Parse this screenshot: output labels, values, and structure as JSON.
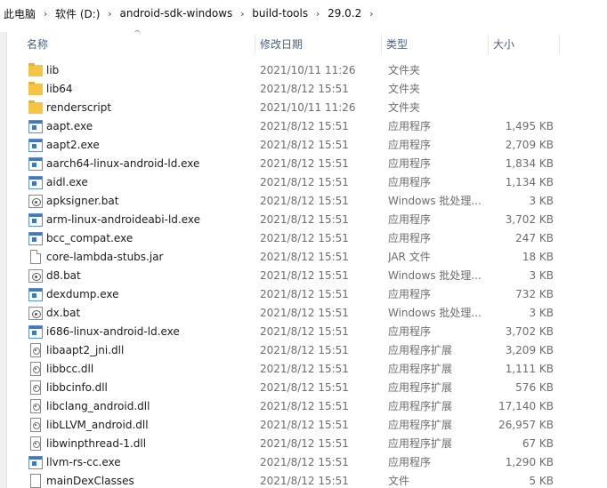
{
  "breadcrumb": {
    "items": [
      "此电脑",
      "软件 (D:)",
      "android-sdk-windows",
      "build-tools",
      "29.0.2"
    ],
    "separator": "›"
  },
  "columns": {
    "name": "名称",
    "date": "修改日期",
    "type": "类型",
    "size": "大小",
    "sort_indicator": "^"
  },
  "files": [
    {
      "name": "lib",
      "date": "2021/10/11 11:26",
      "type": "文件夹",
      "size": "",
      "icon": "folder-icon"
    },
    {
      "name": "lib64",
      "date": "2021/8/12 15:51",
      "type": "文件夹",
      "size": "",
      "icon": "folder-icon"
    },
    {
      "name": "renderscript",
      "date": "2021/10/11 11:26",
      "type": "文件夹",
      "size": "",
      "icon": "folder-icon"
    },
    {
      "name": "aapt.exe",
      "date": "2021/8/12 15:51",
      "type": "应用程序",
      "size": "1,495 KB",
      "icon": "exe-icon"
    },
    {
      "name": "aapt2.exe",
      "date": "2021/8/12 15:51",
      "type": "应用程序",
      "size": "2,709 KB",
      "icon": "exe-icon"
    },
    {
      "name": "aarch64-linux-android-ld.exe",
      "date": "2021/8/12 15:51",
      "type": "应用程序",
      "size": "1,834 KB",
      "icon": "exe-icon"
    },
    {
      "name": "aidl.exe",
      "date": "2021/8/12 15:51",
      "type": "应用程序",
      "size": "1,134 KB",
      "icon": "exe-icon"
    },
    {
      "name": "apksigner.bat",
      "date": "2021/8/12 15:51",
      "type": "Windows 批处理...",
      "size": "3 KB",
      "icon": "bat-icon"
    },
    {
      "name": "arm-linux-androideabi-ld.exe",
      "date": "2021/8/12 15:51",
      "type": "应用程序",
      "size": "3,702 KB",
      "icon": "exe-icon"
    },
    {
      "name": "bcc_compat.exe",
      "date": "2021/8/12 15:51",
      "type": "应用程序",
      "size": "247 KB",
      "icon": "exe-icon"
    },
    {
      "name": "core-lambda-stubs.jar",
      "date": "2021/8/12 15:51",
      "type": "JAR 文件",
      "size": "18 KB",
      "icon": "jar-icon"
    },
    {
      "name": "d8.bat",
      "date": "2021/8/12 15:51",
      "type": "Windows 批处理...",
      "size": "3 KB",
      "icon": "bat-icon"
    },
    {
      "name": "dexdump.exe",
      "date": "2021/8/12 15:51",
      "type": "应用程序",
      "size": "732 KB",
      "icon": "exe-icon"
    },
    {
      "name": "dx.bat",
      "date": "2021/8/12 15:51",
      "type": "Windows 批处理...",
      "size": "3 KB",
      "icon": "bat-icon"
    },
    {
      "name": "i686-linux-android-ld.exe",
      "date": "2021/8/12 15:51",
      "type": "应用程序",
      "size": "3,702 KB",
      "icon": "exe-icon"
    },
    {
      "name": "libaapt2_jni.dll",
      "date": "2021/8/12 15:51",
      "type": "应用程序扩展",
      "size": "3,209 KB",
      "icon": "dll-icon"
    },
    {
      "name": "libbcc.dll",
      "date": "2021/8/12 15:51",
      "type": "应用程序扩展",
      "size": "1,111 KB",
      "icon": "dll-icon"
    },
    {
      "name": "libbcinfo.dll",
      "date": "2021/8/12 15:51",
      "type": "应用程序扩展",
      "size": "576 KB",
      "icon": "dll-icon"
    },
    {
      "name": "libclang_android.dll",
      "date": "2021/8/12 15:51",
      "type": "应用程序扩展",
      "size": "17,140 KB",
      "icon": "dll-icon"
    },
    {
      "name": "libLLVM_android.dll",
      "date": "2021/8/12 15:51",
      "type": "应用程序扩展",
      "size": "26,957 KB",
      "icon": "dll-icon"
    },
    {
      "name": "libwinpthread-1.dll",
      "date": "2021/8/12 15:51",
      "type": "应用程序扩展",
      "size": "67 KB",
      "icon": "dll-icon"
    },
    {
      "name": "llvm-rs-cc.exe",
      "date": "2021/8/12 15:51",
      "type": "应用程序",
      "size": "1,290 KB",
      "icon": "exe-icon"
    },
    {
      "name": "mainDexClasses",
      "date": "2021/8/12 15:51",
      "type": "文件",
      "size": "5 KB",
      "icon": "file-icon"
    }
  ]
}
